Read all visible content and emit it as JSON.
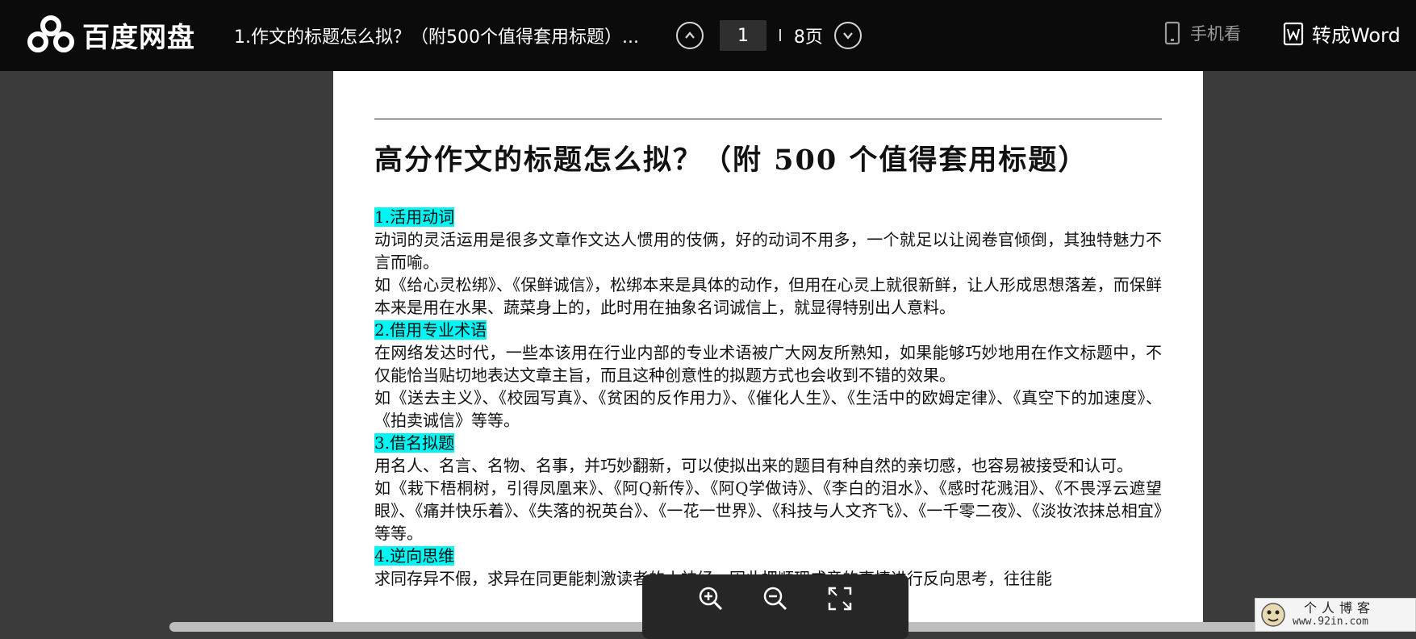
{
  "brand": {
    "name": "百度网盘",
    "color": "#ffffff"
  },
  "document": {
    "tab_title": "1.作文的标题怎么拟？（附500个值得套用标题）..."
  },
  "pager": {
    "current_page": "1",
    "separator": "I",
    "total": "8页",
    "prev_icon": "chevron-up-circle",
    "next_icon": "chevron-down-circle"
  },
  "toolbar": {
    "mobile_label": "手机看",
    "word_label": "转成Word"
  },
  "page": {
    "title": "高分作文的标题怎么拟？（附 500 个值得套用标题）",
    "s1": {
      "heading": "1.活用动词",
      "p1": "动词的灵活运用是很多文章作文达人惯用的伎俩，好的动词不用多，一个就足以让阅卷官倾倒，其独特魅力不言而喻。",
      "p2": "如《给心灵松绑》、《保鲜诚信》，松绑本来是具体的动作，但用在心灵上就很新鲜，让人形成思想落差，而保鲜本来是用在水果、蔬菜身上的，此时用在抽象名词诚信上，就显得特别出人意料。"
    },
    "s2": {
      "heading": "2.借用专业术语",
      "p1": "在网络发达时代，一些本该用在行业内部的专业术语被广大网友所熟知，如果能够巧妙地用在作文标题中，不仅能恰当贴切地表达文章主旨，而且这种创意性的拟题方式也会收到不错的效果。",
      "p2": "如《送去主义》、《校园写真》、《贫困的反作用力》、《催化人生》、《生活中的欧姆定律》、《真空下的加速度》、《拍卖诚信》等等。"
    },
    "s3": {
      "heading": "3.借名拟题",
      "p1": "用名人、名言、名物、名事，并巧妙翻新，可以使拟出来的题目有种自然的亲切感，也容易被接受和认可。",
      "p2": "如《栽下梧桐树，引得凤凰来》、《阿Q新传》、《阿Q学做诗》、《李白的泪水》、《感时花溅泪》、《不畏浮云遮望眼》、《痛并快乐着》、《失落的祝英台》、《一花一世界》、《科技与人文齐飞》、《一千零二夜》、《淡妆浓抹总相宜》等等。"
    },
    "s4": {
      "heading": "4.逆向思维",
      "p1": "求同存异不假，求异在同更能刺激读者的小神经，因此把顺理成章的事情进行反向思考，往往能"
    }
  },
  "zoom_controls": {
    "zoom_in_icon": "zoom-in-icon",
    "zoom_out_icon": "zoom-out-icon",
    "fullscreen_icon": "fullscreen-icon"
  },
  "watermark": {
    "title": "个人博客",
    "url": "www.92in.com"
  },
  "colors": {
    "topbar": "#0b0b0b",
    "background": "#3b3b3b",
    "highlight": "#00f5f5"
  }
}
